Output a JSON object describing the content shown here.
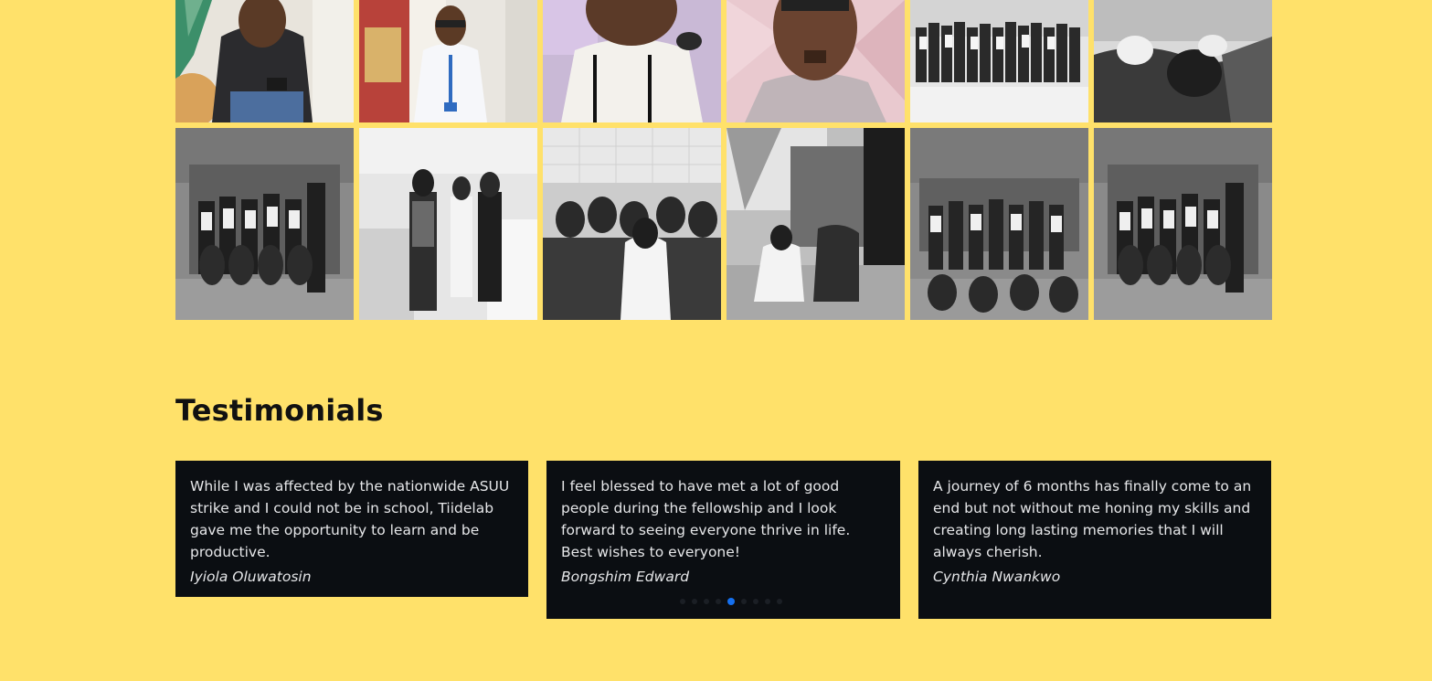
{
  "testimonials": {
    "title": "Testimonials",
    "items": [
      {
        "quote": "While I was affected by the nationwide ASUU strike and I could not be in school, Tiidelab gave me the opportunity to learn and be productive.",
        "author": "Iyiola Oluwatosin"
      },
      {
        "quote": "I feel blessed to have met a lot of good people during the fellowship and I look forward to seeing everyone thrive in life. Best wishes to everyone!",
        "author": "Bongshim Edward"
      },
      {
        "quote": "A journey of 6 months has finally come to an end but not without me honing my skills and creating long lasting memories that I will always cherish.",
        "author": "Cynthia Nwankwo"
      }
    ],
    "carousel": {
      "dot_count": 9,
      "active_index": 4,
      "active_color": "#1570EF"
    }
  },
  "theme": {
    "background": "#FFE16A",
    "card_background": "#0B0E12"
  }
}
